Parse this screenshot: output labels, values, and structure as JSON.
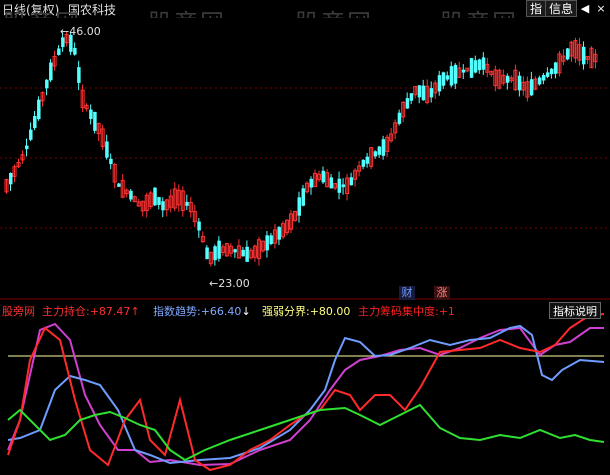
{
  "header": {
    "period": "日线(复权)",
    "stock_name": "国农科技",
    "btn_zhi": "指",
    "btn_info": "信息",
    "btn_back": "◀",
    "btn_close": "×"
  },
  "watermark": "股旁网",
  "price_labels": {
    "high": "46.00",
    "low": "23.00"
  },
  "event_markers": {
    "finance": "财",
    "rise": "涨"
  },
  "indicator_panel": {
    "name": "股旁网",
    "items": [
      {
        "label": "主力持仓:",
        "value": "+87.47",
        "arrow": "↑",
        "color": "#ff4040",
        "arrow_color": "#ff4040"
      },
      {
        "label": "指数趋势:",
        "value": "+66.40",
        "arrow": "↓",
        "color": "#7fa8ff",
        "arrow_color": "#ffffff"
      },
      {
        "label": "强弱分界:",
        "value": "+80.00",
        "arrow": "",
        "color": "#ffff80",
        "arrow_color": "#ffffff"
      },
      {
        "label": "主力筹码集中度:",
        "value": "+1",
        "arrow": "",
        "color": "#ff2020",
        "arrow_color": "#ffffff"
      }
    ],
    "help_button": "指标说明"
  },
  "chart_data": {
    "type": "line",
    "title": "",
    "candles_high": 46.0,
    "candles_low": 23.0,
    "indicator": {
      "threshold": 80.0,
      "series": [
        {
          "name": "主力持仓",
          "color": "#ff3030",
          "last": 87.47
        },
        {
          "name": "指数趋势",
          "color": "#6f9cff",
          "last": 66.4
        },
        {
          "name": "强弱分界",
          "color": "#ffffa0",
          "last": 80.0
        },
        {
          "name": "主力筹码集中度",
          "color": "#ff2020",
          "last": 1
        }
      ]
    }
  },
  "colors": {
    "up": "#ff3232",
    "down": "#54ffff",
    "grid": "#7a0000"
  }
}
